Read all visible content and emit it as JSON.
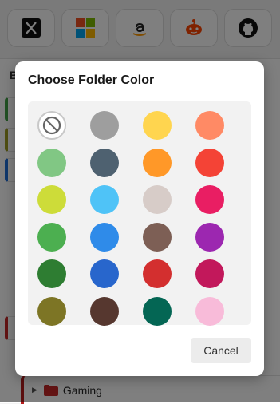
{
  "shortcuts": [
    {
      "icon": "x-twitter-icon"
    },
    {
      "icon": "microsoft-icon"
    },
    {
      "icon": "amazon-icon"
    },
    {
      "icon": "reddit-icon"
    },
    {
      "icon": "github-icon"
    }
  ],
  "background": {
    "section_letter": "B",
    "gaming_folder_label": "Gaming",
    "gaming_folder_color": "#b71c1c"
  },
  "dialog": {
    "title": "Choose Folder Color",
    "cancel_label": "Cancel",
    "colors": [
      "none",
      "#9e9e9e",
      "#ffd54f",
      "#ff8a65",
      "#81c784",
      "#4e6170",
      "#ff9828",
      "#f44336",
      "#cddc39",
      "#4fc3f7",
      "#d7ccc8",
      "#e91e63",
      "#4caf50",
      "#2f8be9",
      "#7d5f55",
      "#9c27b0",
      "#2e7d32",
      "#2866cc",
      "#d32f2f",
      "#c2185b",
      "#7d7525",
      "#56372f",
      "#046654",
      "#f8bbd9"
    ]
  }
}
